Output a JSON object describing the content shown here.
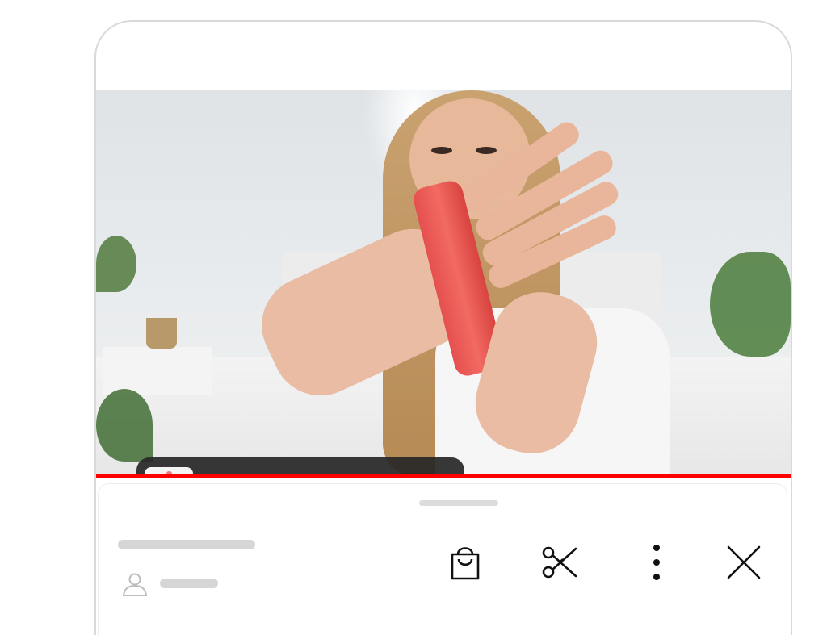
{
  "player": {
    "mini_player": {
      "thumbnail_icon": "lipstick-thumbnail",
      "open_icon": "open-external-icon",
      "close_icon": "close-icon"
    },
    "progress_color": "#ff0000"
  },
  "sheet": {
    "actions": [
      {
        "name": "shop",
        "icon": "shopping-bag-icon"
      },
      {
        "name": "clip",
        "icon": "scissors-icon"
      },
      {
        "name": "more",
        "icon": "more-vertical-icon"
      },
      {
        "name": "close",
        "icon": "close-icon"
      }
    ],
    "channel_icon": "person-icon"
  }
}
